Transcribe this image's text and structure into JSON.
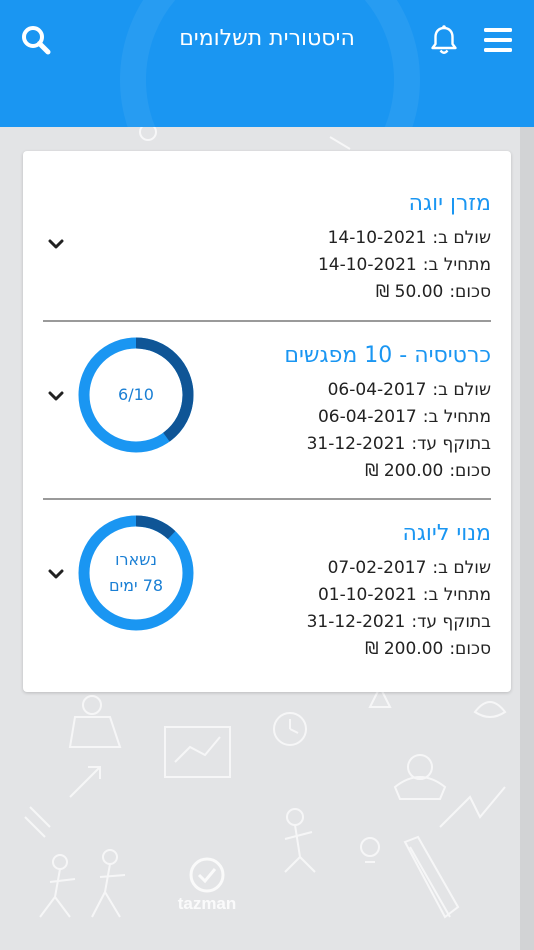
{
  "header": {
    "title": "היסטורית תשלומים",
    "icons": [
      "menu-icon",
      "bell-icon",
      "search-icon"
    ]
  },
  "colors": {
    "primary": "#1a96f2",
    "ring_track": "#1a96f2",
    "ring_progress": "#0f5596",
    "background": "#e3e4e6"
  },
  "background_logo": "tazman",
  "payments": [
    {
      "title": "מזרן יוגה",
      "paid_label": "שולם ב:",
      "paid_date": "14-10-2021",
      "start_label": "מתחיל ב:",
      "start_date": "14-10-2021",
      "amount_label": "סכום:",
      "amount": "50.00 ₪"
    },
    {
      "title": "כרטיסיה - 10 מפגשים",
      "paid_label": "שולם ב:",
      "paid_date": "06-04-2017",
      "start_label": "מתחיל ב:",
      "start_date": "06-04-2017",
      "valid_label": "בתוקף עד:",
      "valid_date": "31-12-2021",
      "amount_label": "סכום:",
      "amount": "200.00 ₪",
      "ring_text": "6/10",
      "ring_progress": 0.4
    },
    {
      "title": "מנוי ליוגה",
      "paid_label": "שולם ב:",
      "paid_date": "07-02-2017",
      "start_label": "מתחיל ב:",
      "start_date": "01-10-2021",
      "valid_label": "בתוקף עד:",
      "valid_date": "31-12-2021",
      "amount_label": "סכום:",
      "amount": "200.00 ₪",
      "ring_line1": "נשארו",
      "ring_line2": "78 ימים",
      "ring_progress": 0.12
    }
  ]
}
